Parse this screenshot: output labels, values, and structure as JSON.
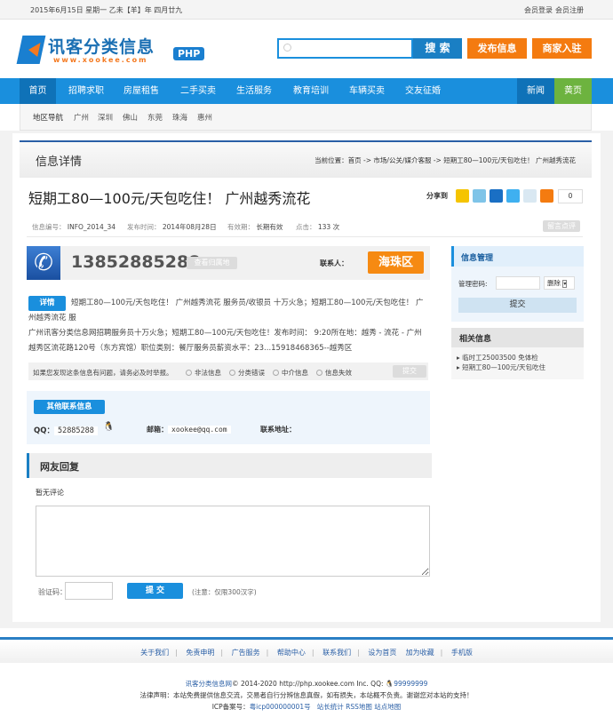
{
  "topbar": {
    "date": "2015年6月15日 星期一  乙未【羊】年 四月廿九",
    "login": "会员登录",
    "register": "会员注册"
  },
  "logo": {
    "name": "讯客分类信息",
    "url": "www.xookee.com",
    "badge": "PHP"
  },
  "search": {
    "placeholder": "",
    "button": "搜 索"
  },
  "header_buttons": {
    "publish": "发布信息",
    "merchant": "商家入驻"
  },
  "nav": [
    "首页",
    "招聘求职",
    "房屋租售",
    "二手买卖",
    "生活服务",
    "教育培训",
    "车辆买卖",
    "交友征婚"
  ],
  "nav_right": [
    "新闻",
    "黄页"
  ],
  "region": {
    "label": "地区导航",
    "items": [
      "广州",
      "深圳",
      "佛山",
      "东莞",
      "珠海",
      "惠州"
    ]
  },
  "detail_header": {
    "title": "信息详情",
    "breadcrumb": "当前位置：首页 -> 市场/公关/媒介客服 -> 短期工80—100元/天包吃住！ 广州越秀流花"
  },
  "post": {
    "title": "短期工80—100元/天包吃住！ 广州越秀流花",
    "share_label": "分享到",
    "share_count": "0",
    "meta": {
      "id_label": "信息编号：",
      "id": "INFO_2014_34",
      "time_label": "发布时间：",
      "time": "2014年08月28日",
      "valid_label": "有效期：",
      "valid": "长期有效",
      "clicks_label": "点击：",
      "clicks": "133 次"
    },
    "comment_button": "留言点评",
    "phone": "13852885288",
    "phone_lookup": "查看归属地",
    "contact_label": "联系人：",
    "district": "海珠区",
    "detail_tag": "详情",
    "detail_text": "短期工80—100元/天包吃住！ 广州越秀流花 服务员/收银员 十万火急；短期工80—100元/天包吃住！ 广州越秀流花 服",
    "detail_text2": "广州讯客分类信息网招聘服务员十万火急；短期工80—100元/天包吃住！发布时间： 9:20所在地：越秀 - 流花 - 广州越秀区流花路120号（东方宾馆）职位类别：餐厅服务员薪资水平：23...15918468365--越秀区"
  },
  "report": {
    "text": "如果您发现这条信息有问题，请务必及时举报。",
    "options": [
      "非法信息",
      "分类错误",
      "中介信息",
      "信息失效"
    ],
    "submit": "提交"
  },
  "other_contact": {
    "tag": "其他联系信息",
    "qq_label": "QQ：",
    "qq": "52885288",
    "email_label": "邮箱：",
    "email": "xookee@qq.com",
    "address_label": "联系地址："
  },
  "reply": {
    "title": "网友回复",
    "empty": "暂无评论",
    "captcha_label": "验证码：",
    "submit": "提 交",
    "note": "(注意：仅限300汉字)"
  },
  "sidebar": {
    "manage_title": "信息管理",
    "password_label": "管理密码:",
    "action": "删除",
    "submit": "提交",
    "related_title": "相关信息",
    "related": [
      "临时工25003500 免体检",
      "短期工80—100元/天包吃住"
    ]
  },
  "footer": {
    "links": [
      "关于我们",
      "免责申明",
      "广告服务",
      "帮助中心",
      "联系我们",
      "设为首页",
      "加为收藏",
      "手机版"
    ],
    "site": "讯客分类信息网",
    "copyright": "© 2014-2020 http://php.xookee.com Inc. QQ:",
    "qq": "99999999",
    "legal": "法律声明：本站免费提供信息交流，交易者自行分辨信息真假，如有损失，本站概不负责。谢谢您对本站的支持！",
    "icp_label": "ICP备案号：",
    "icp": "粤icp000000001号",
    "extra": [
      "站长统计",
      "RSS地图",
      "站点地图"
    ]
  }
}
